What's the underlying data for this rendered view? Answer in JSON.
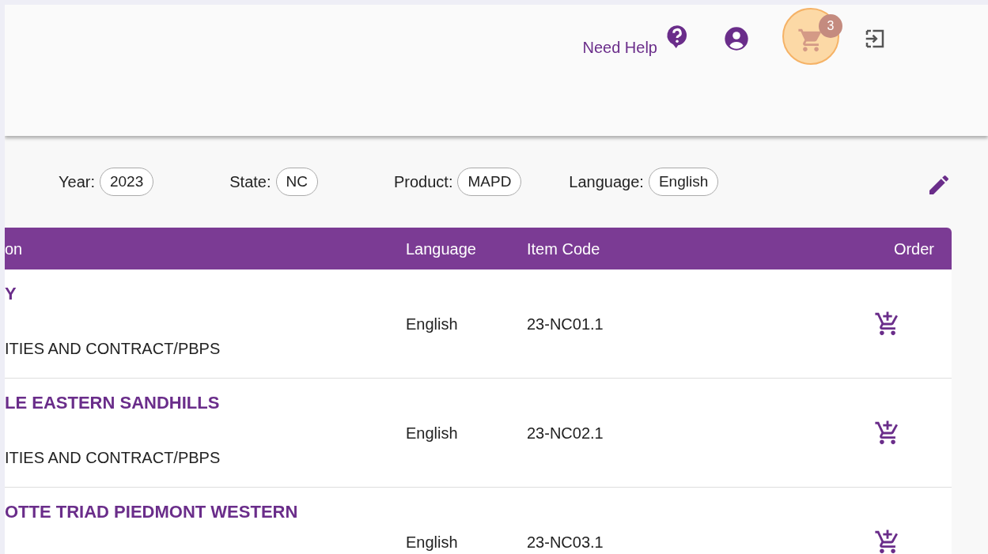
{
  "header": {
    "help_link": "Need Help",
    "cart_count": "3",
    "cart_highlighted": true
  },
  "filters": [
    {
      "label": "Year:",
      "value": "2023"
    },
    {
      "label": "State:",
      "value": "NC"
    },
    {
      "label": "Product:",
      "value": "MAPD"
    },
    {
      "label": "Language:",
      "value": "English"
    }
  ],
  "table": {
    "columns": [
      "on",
      "Language",
      "Item Code",
      "Order"
    ],
    "rows": [
      {
        "title": "Y",
        "subtitle": "ITIES AND CONTRACT/PBPS",
        "language": "English",
        "item_code": "23-NC01.1"
      },
      {
        "title": "LE EASTERN SANDHILLS",
        "subtitle": "ITIES AND CONTRACT/PBPS",
        "language": "English",
        "item_code": "23-NC02.1"
      },
      {
        "title": "OTTE TRIAD PIEDMONT WESTERN",
        "language": "English",
        "item_code": "23-NC03.1"
      }
    ]
  }
}
